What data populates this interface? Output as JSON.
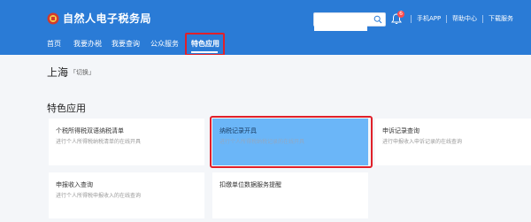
{
  "header": {
    "app_title": "自然人电子税务局",
    "search": {
      "placeholder": "",
      "value": ""
    },
    "notification_count": "6",
    "links": [
      "手机APP",
      "帮助中心",
      "下载服务"
    ]
  },
  "nav": {
    "items": [
      "首页",
      "我要办税",
      "我要查询",
      "公众服务",
      "特色应用"
    ],
    "active": "特色应用"
  },
  "location": {
    "city": "上海",
    "switch_label": "「切换」"
  },
  "section": {
    "title": "特色应用"
  },
  "cards": [
    {
      "title": "个税所得税双语纳税清单",
      "desc": "进行个人所得税纳税清单的在线开具"
    },
    {
      "title": "纳税记录开具",
      "desc": "进行个人所得税纳税记录的在线开具"
    },
    {
      "title": "申诉记录查询",
      "desc": "进行申报收入申诉记录的在线查询"
    },
    {
      "title": "申报收入查询",
      "desc": "进行个人所得税申报收入的在线查询"
    },
    {
      "title": "扣缴单位数据服务提醒",
      "desc": ""
    }
  ],
  "colors": {
    "header": "#2a7bd6",
    "hover_card": "#6bb6f8",
    "highlight": "#e0202a"
  }
}
